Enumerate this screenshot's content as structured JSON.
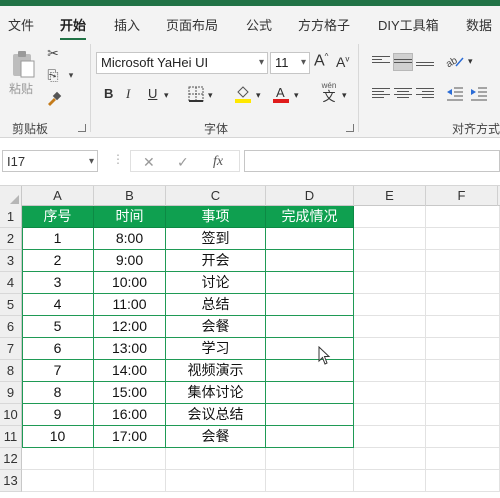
{
  "ribbon": {
    "tabs": [
      "文件",
      "开始",
      "插入",
      "页面布局",
      "公式",
      "方方格子",
      "DIY工具箱",
      "数据"
    ],
    "active_tab": "开始",
    "paste_label": "粘贴",
    "clipboard_label": "剪贴板",
    "font_label": "字体",
    "align_label": "对齐方式",
    "font_name": "Microsoft YaHei UI",
    "font_size": "11",
    "grow_font": "A",
    "shrink_font": "A",
    "bold": "B",
    "italic": "I",
    "underline": "U",
    "phonetic_top": "wén",
    "phonetic_bottom": "文",
    "font_color": "#e01b1b",
    "fill_color": "#ffe800"
  },
  "formula_bar": {
    "name_box": "I17",
    "fx": "fx",
    "cancel": "✕",
    "enter": "✓",
    "formula": ""
  },
  "columns": [
    "A",
    "B",
    "C",
    "D",
    "E",
    "F"
  ],
  "rows": [
    "1",
    "2",
    "3",
    "4",
    "5",
    "6",
    "7",
    "8",
    "9",
    "10",
    "11",
    "12",
    "13"
  ],
  "table": {
    "headers": [
      "序号",
      "时间",
      "事项",
      "完成情况"
    ],
    "rows": [
      [
        "1",
        "8:00",
        "签到",
        ""
      ],
      [
        "2",
        "9:00",
        "开会",
        ""
      ],
      [
        "3",
        "10:00",
        "讨论",
        ""
      ],
      [
        "4",
        "11:00",
        "总结",
        ""
      ],
      [
        "5",
        "12:00",
        "会餐",
        ""
      ],
      [
        "6",
        "13:00",
        "学习",
        ""
      ],
      [
        "7",
        "14:00",
        "视频演示",
        ""
      ],
      [
        "8",
        "15:00",
        "集体讨论",
        ""
      ],
      [
        "9",
        "16:00",
        "会议总结",
        ""
      ],
      [
        "10",
        "17:00",
        "会餐",
        ""
      ]
    ]
  },
  "colors": {
    "header_fill": "#0fa050",
    "table_border": "#1f9a55",
    "brand": "#217346"
  }
}
